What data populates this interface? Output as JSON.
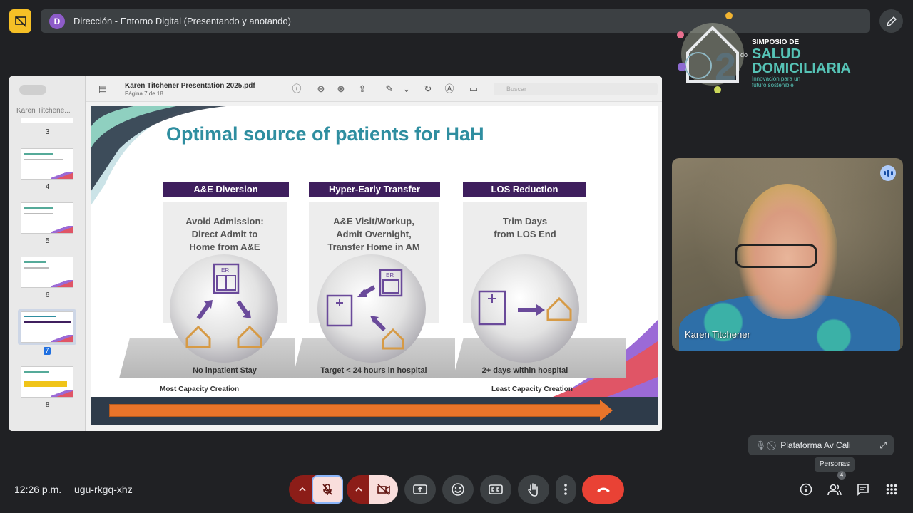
{
  "meeting": {
    "presenter_initial": "D",
    "presenter_title": "Dirección - Entorno Digital (Presentando y anotando)",
    "time": "12:26 p.m.",
    "code": "ugu-rkgq-xhz"
  },
  "logo": {
    "line1": "SIMPOSIO DE",
    "line2": "SALUD",
    "line3": "DOMICILIARIA",
    "line4": "Innovación para un futuro sostenible",
    "edition": "2",
    "edition_suffix": "do"
  },
  "pdf": {
    "sidebar_title": "Karen Titchene...",
    "doc_title": "Karen Titchener Presentation 2025.pdf",
    "page_info": "Página 7 de 18",
    "search_placeholder": "Buscar",
    "thumbnails": [
      "3",
      "4",
      "5",
      "6",
      "7",
      "8"
    ],
    "selected_page": "7"
  },
  "slide": {
    "title": "Optimal source of patients for HaH",
    "columns": [
      {
        "header": "A&E Diversion",
        "line1": "Avoid Admission:",
        "line2": "Direct Admit to",
        "line3": "Home from A&E",
        "platform": "No inpatient Stay"
      },
      {
        "header": "Hyper-Early Transfer",
        "line1": "A&E Visit/Workup,",
        "line2": "Admit Overnight,",
        "line3": "Transfer Home in AM",
        "platform": "Target < 24 hours in hospital"
      },
      {
        "header": "LOS Reduction",
        "line1": "Trim Days",
        "line2": "from LOS End",
        "line3": "",
        "platform": "2+ days within hospital"
      }
    ],
    "left_caption": "Most Capacity Creation",
    "right_caption": "Least Capacity Creation",
    "er_label": "ER"
  },
  "participants": {
    "main_name": "Karen Titchener",
    "small_tile_name": "Plataforma Av Cali",
    "people_tooltip": "Personas",
    "people_count": "4"
  },
  "colors": {
    "accent_purple": "#3f1f5e",
    "title_teal": "#2f8ea0",
    "arrow_orange": "#e8742a",
    "end_call_red": "#e94235"
  }
}
